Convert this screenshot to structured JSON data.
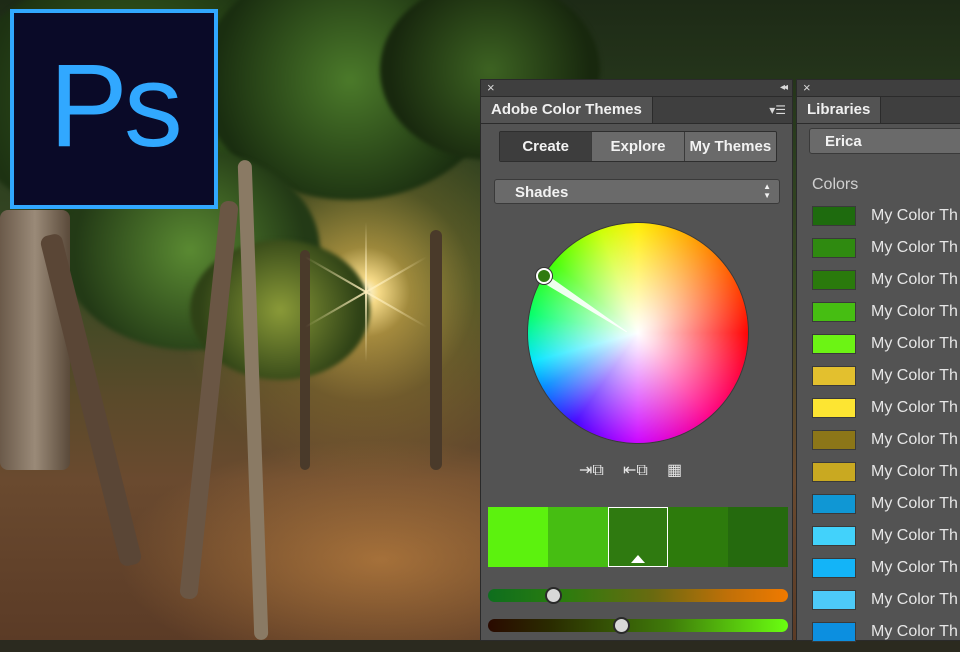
{
  "logo": {
    "text": "Ps",
    "brand_color": "#31a8ff",
    "background": "#0a0a28"
  },
  "color_themes_panel": {
    "tab_title": "Adobe Color Themes",
    "close_icon": "close-icon",
    "collapse_icon": "double-chevron-icon",
    "menu_icon": "panel-menu-icon",
    "modes": [
      {
        "label": "Create",
        "active": true
      },
      {
        "label": "Explore",
        "active": false
      },
      {
        "label": "My Themes",
        "active": false
      }
    ],
    "color_rule": "Shades",
    "wheel_handle_color": "#2f7a10",
    "tools": [
      "set-base-color-icon",
      "get-base-color-icon",
      "add-to-swatches-icon"
    ],
    "swatches": [
      {
        "color": "#5cf20e",
        "selected": false
      },
      {
        "color": "#46be12",
        "selected": false
      },
      {
        "color": "#2f7a10",
        "selected": true
      },
      {
        "color": "#2d7b0c",
        "selected": false
      },
      {
        "color": "#256a0e",
        "selected": false
      }
    ],
    "sliders": [
      {
        "name": "hue-slider",
        "value": 0.2
      },
      {
        "name": "brightness-slider",
        "value": 0.44
      }
    ]
  },
  "libraries_panel": {
    "tab_title": "Libraries",
    "library": "Erica",
    "section": "Colors",
    "colors": [
      {
        "name": "My Color Th",
        "color": "#1e6b0e"
      },
      {
        "name": "My Color Th",
        "color": "#2f8a10"
      },
      {
        "name": "My Color Th",
        "color": "#2a7a0c"
      },
      {
        "name": "My Color Th",
        "color": "#46be12"
      },
      {
        "name": "My Color Th",
        "color": "#6cf414"
      },
      {
        "name": "My Color Th",
        "color": "#e3c02e"
      },
      {
        "name": "My Color Th",
        "color": "#fde532"
      },
      {
        "name": "My Color Th",
        "color": "#8c7618"
      },
      {
        "name": "My Color Th",
        "color": "#c9a921"
      },
      {
        "name": "My Color Th",
        "color": "#1097d4"
      },
      {
        "name": "My Color Th",
        "color": "#42d2fb"
      },
      {
        "name": "My Color Th",
        "color": "#13b4f8"
      },
      {
        "name": "My Color Th",
        "color": "#4dcaf8"
      },
      {
        "name": "My Color Th",
        "color": "#0c8fe0"
      }
    ]
  }
}
